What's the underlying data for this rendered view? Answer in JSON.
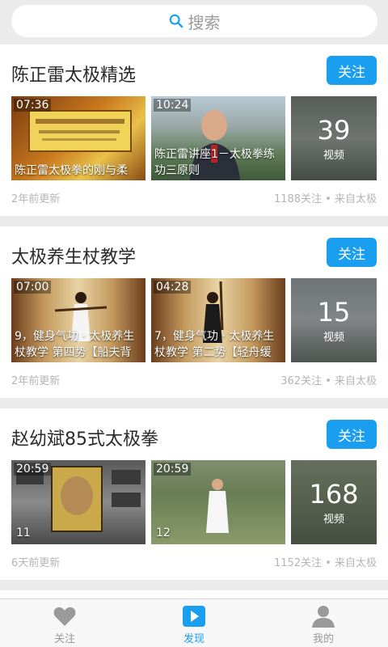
{
  "search": {
    "placeholder": "搜索"
  },
  "cards": [
    {
      "title": "陈正雷太极精选",
      "follow_label": "关注",
      "videos": [
        {
          "duration": "07:36",
          "caption": "陈正雷太极拳的刚与柔"
        },
        {
          "duration": "10:24",
          "caption": "陈正雷讲座1－太极拳练功三原则"
        }
      ],
      "more": {
        "count": "39",
        "label": "视频"
      },
      "updated": "2年前更新",
      "stats": "1188关注 • 来自太极"
    },
    {
      "title": "太极养生杖教学",
      "follow_label": "关注",
      "videos": [
        {
          "duration": "07:00",
          "caption": "9，健身气功 · 太极养生杖教学 第四势【船夫背"
        },
        {
          "duration": "04:28",
          "caption": "7，健身气功 · 太极养生杖教学 第二势【轻舟缓"
        }
      ],
      "more": {
        "count": "15",
        "label": "视频"
      },
      "updated": "2年前更新",
      "stats": "362关注 • 来自太极"
    },
    {
      "title": "赵幼斌85式太极拳",
      "follow_label": "关注",
      "videos": [
        {
          "duration": "20:59",
          "caption": "11"
        },
        {
          "duration": "20:59",
          "caption": "12"
        }
      ],
      "more": {
        "count": "168",
        "label": "视频"
      },
      "updated": "6天前更新",
      "stats": "1152关注 • 来自太极"
    }
  ],
  "tabbar": {
    "items": [
      {
        "label": "关注",
        "icon": "heart-icon"
      },
      {
        "label": "发现",
        "icon": "play-icon"
      },
      {
        "label": "我的",
        "icon": "user-icon"
      }
    ],
    "active_color": "#1a9ff0"
  }
}
